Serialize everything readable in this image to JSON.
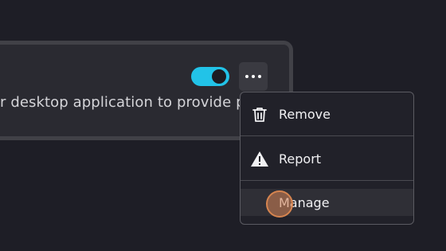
{
  "card": {
    "description": "r desktop application to provide p"
  },
  "toggle": {
    "state": "on",
    "color": "#22c3e8"
  },
  "more_button": {
    "icon": "more-horizontal-icon"
  },
  "menu": {
    "items": [
      {
        "label": "Remove",
        "icon": "trash-icon"
      },
      {
        "label": "Report",
        "icon": "warning-icon"
      },
      {
        "label": "Manage",
        "icon": "none"
      }
    ]
  }
}
